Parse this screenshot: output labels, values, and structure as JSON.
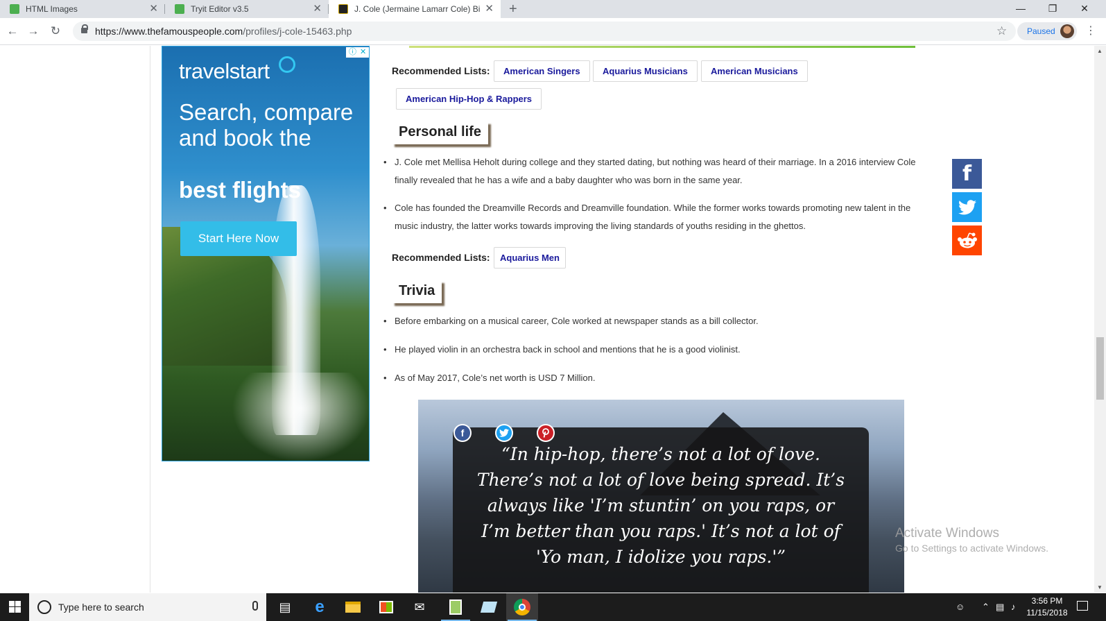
{
  "browser": {
    "tabs": [
      {
        "title": "HTML Images",
        "active": false
      },
      {
        "title": "Tryit Editor v3.5",
        "active": false
      },
      {
        "title": "J. Cole (Jermaine Lamarr Cole) Bi",
        "active": true
      }
    ],
    "new_tab_label": "+",
    "window_controls": {
      "minimize": "—",
      "restore": "❐",
      "close": "✕"
    },
    "url_host": "https://www.thefamouspeople.com",
    "url_path": "/profiles/j-cole-15463.php",
    "profile_status": "Paused",
    "icons": {
      "back": "arrow-left",
      "forward": "arrow-right",
      "reload": "reload",
      "bookmark": "star",
      "menu": "kebab"
    }
  },
  "ad": {
    "brand": "travelstart",
    "headline": "Search, compare and book the",
    "headline_bold": "best flights",
    "cta": "Start Here Now",
    "choices_icons": [
      "ⓘ",
      "✕"
    ],
    "accent_color": "#33bde8"
  },
  "article": {
    "recommended_label": "Recommended Lists:",
    "recommended_lists_1": [
      "American Singers",
      "Aquarius Musicians",
      "American Musicians",
      "American Hip-Hop & Rappers"
    ],
    "personal_life": {
      "heading": "Personal life",
      "items": [
        "J. Cole met Mellisa Heholt during college and they started dating, but nothing was heard of their marriage. In a 2016 interview Cole finally revealed that he has a wife and a baby daughter who was born in the same year.",
        "Cole has founded the Dreamville Records and Dreamville foundation. While the former works towards promoting new talent in the music industry, the latter works towards improving the living standards of youths residing in the ghettos."
      ]
    },
    "recommended_lists_2": [
      "Aquarius Men"
    ],
    "trivia": {
      "heading": "Trivia",
      "items": [
        "Before embarking on a musical career, Cole worked at newspaper stands as a bill collector.",
        "He played violin in an orchestra back in school and mentions that he is a good violinist.",
        "As of May 2017, Cole’s net worth is USD 7 Million."
      ]
    },
    "quote": "“In hip-hop, there’s not a lot of love. There’s not a lot of love being spread. It’s always like 'I’m stuntin’ on you raps, or I’m better than you raps.' It’s not a lot of 'Yo man, I idolize you raps.'”"
  },
  "share": {
    "facebook": "f",
    "colors": {
      "facebook": "#3b5998",
      "twitter": "#1da1f2",
      "reddit": "#ff4500"
    }
  },
  "watermark": {
    "title": "Activate Windows",
    "subtitle": "Go to Settings to activate Windows."
  },
  "taskbar": {
    "search_placeholder": "Type here to search",
    "time": "3:56 PM",
    "date": "11/15/2018"
  }
}
